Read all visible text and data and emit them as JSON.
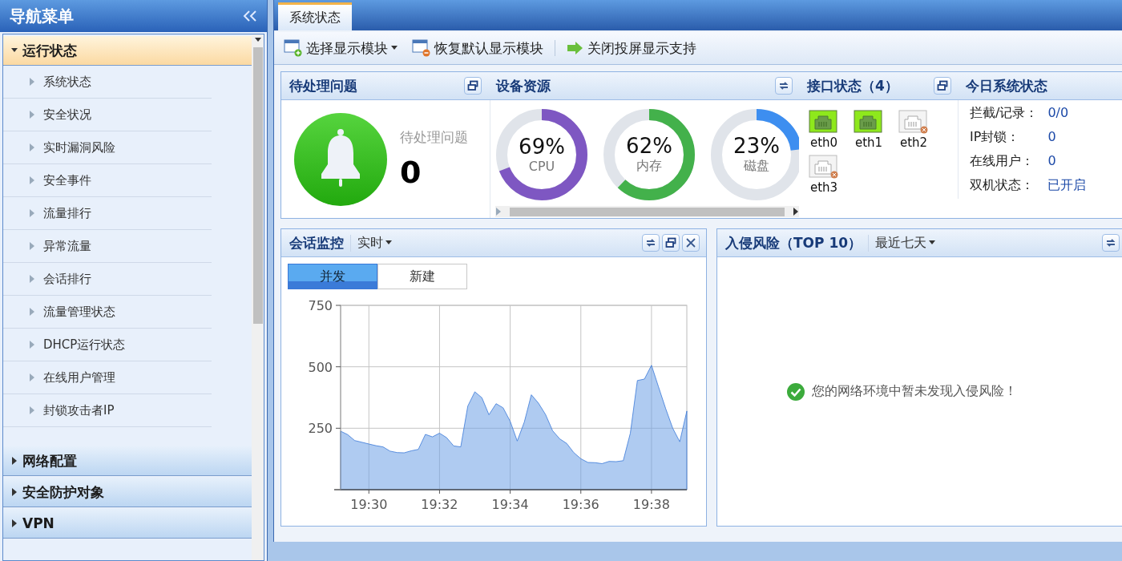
{
  "sidebar": {
    "title": "导航菜单",
    "groups": [
      {
        "label": "运行状态",
        "expanded": true,
        "items": [
          {
            "label": "系统状态"
          },
          {
            "label": "安全状况"
          },
          {
            "label": "实时漏洞风险"
          },
          {
            "label": "安全事件"
          },
          {
            "label": "流量排行"
          },
          {
            "label": "异常流量"
          },
          {
            "label": "会话排行"
          },
          {
            "label": "流量管理状态"
          },
          {
            "label": "DHCP运行状态"
          },
          {
            "label": "在线用户管理"
          },
          {
            "label": "封锁攻击者IP"
          }
        ]
      },
      {
        "label": "网络配置",
        "expanded": false
      },
      {
        "label": "安全防护对象",
        "expanded": false
      },
      {
        "label": "VPN",
        "expanded": false
      }
    ]
  },
  "tabs": [
    {
      "label": "系统状态",
      "selected": true
    }
  ],
  "toolbar": [
    {
      "kind": "add",
      "label": "选择显示模块",
      "dropdown": true
    },
    {
      "kind": "restore",
      "label": "恢复默认显示模块",
      "dropdown": false
    },
    {
      "kind": "arrow",
      "label": "关闭投屏显示支持",
      "dropdown": false
    }
  ],
  "pending": {
    "title": "待处理问题",
    "label": "待处理问题",
    "count": "0"
  },
  "resources": {
    "title": "设备资源",
    "gauges": [
      {
        "value": "69%",
        "label": "CPU",
        "level": 0.69,
        "color": "#7e57c2"
      },
      {
        "value": "62%",
        "label": "内存",
        "level": 0.62,
        "color": "#43b14b"
      },
      {
        "value": "23%",
        "label": "磁盘",
        "level": 0.23,
        "color": "#3d8ef0"
      }
    ]
  },
  "interfaces": {
    "title": "接口状态（4）",
    "ports": [
      {
        "name": "eth0",
        "connected": true
      },
      {
        "name": "eth1",
        "connected": true
      },
      {
        "name": "eth2",
        "connected": false
      },
      {
        "name": "eth3",
        "connected": false
      }
    ]
  },
  "today": {
    "title": "今日系统状态",
    "stats": [
      {
        "label": "拦截/记录：",
        "value": "0/0"
      },
      {
        "label": "IP封锁：",
        "value": "0"
      },
      {
        "label": "在线用户：",
        "value": "0"
      },
      {
        "label": "双机状态：",
        "value": "已开启"
      }
    ]
  },
  "sessions": {
    "title": "会话监控",
    "period": "实时",
    "modes": [
      {
        "label": "并发",
        "selected": true
      },
      {
        "label": "新建",
        "selected": false
      }
    ],
    "chart_data": {
      "type": "area",
      "grid": true,
      "ylim": [
        0,
        750
      ],
      "yticks": [
        250,
        500,
        750
      ],
      "categories": [
        null,
        null,
        null,
        null,
        "19:30",
        null,
        null,
        null,
        null,
        null,
        null,
        null,
        null,
        null,
        "19:32",
        null,
        null,
        null,
        null,
        null,
        null,
        null,
        null,
        null,
        "19:34",
        null,
        null,
        null,
        null,
        null,
        null,
        null,
        null,
        null,
        "19:36",
        null,
        null,
        null,
        null,
        null,
        null,
        null,
        null,
        null,
        "19:38",
        null,
        null,
        null,
        null,
        null
      ],
      "series": [
        {
          "color": "#3a78d8",
          "values": [
            238,
            224,
            200,
            193,
            186,
            179,
            174,
            157,
            151,
            150,
            158,
            164,
            225,
            215,
            230,
            212,
            178,
            174,
            340,
            398,
            374,
            305,
            350,
            333,
            278,
            198,
            275,
            386,
            352,
            306,
            240,
            207,
            188,
            151,
            126,
            111,
            110,
            106,
            115,
            114,
            118,
            230,
            444,
            450,
            506,
            418,
            330,
            250,
            195,
            320
          ]
        }
      ]
    }
  },
  "intrusion": {
    "title": "入侵风险（TOP 10）",
    "period": "最近七天",
    "message": "您的网络环境中暂未发现入侵风险！"
  }
}
